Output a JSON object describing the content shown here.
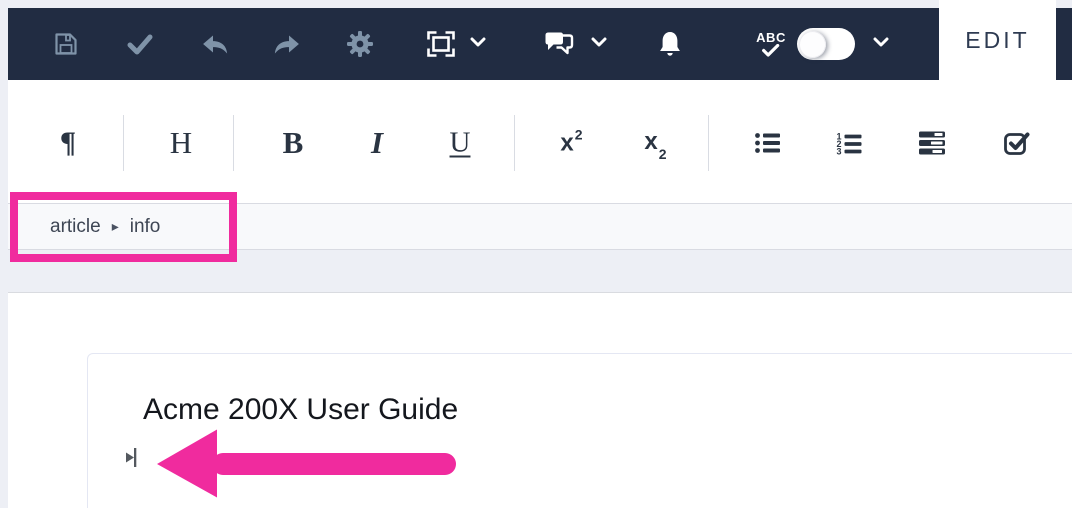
{
  "colors": {
    "accent_pink": "#f02b9e",
    "topbar_bg": "#212c42",
    "muted_icon": "#7f93a8",
    "white_icon": "#ffffff",
    "format_icon": "#2a3442"
  },
  "top_toolbar": {
    "buttons": [
      {
        "id": "save",
        "icon": "floppy-icon"
      },
      {
        "id": "approve",
        "icon": "check-icon"
      },
      {
        "id": "undo",
        "icon": "undo-arrow-icon"
      },
      {
        "id": "redo",
        "icon": "redo-arrow-icon"
      },
      {
        "id": "settings",
        "icon": "gear-icon"
      },
      {
        "id": "layout-mode",
        "icon": "frame-corners-icon",
        "has_dropdown": true
      },
      {
        "id": "comments",
        "icon": "speech-bubbles-icon",
        "has_dropdown": true
      },
      {
        "id": "notifications",
        "icon": "bell-icon"
      },
      {
        "id": "spellcheck",
        "icon": "abc-check-icon",
        "has_dropdown": true
      }
    ],
    "spellcheck_label": "ABC",
    "spellcheck_toggle_state": "off",
    "edit_tab_label": "EDIT"
  },
  "format_toolbar": {
    "paragraph_label": "¶",
    "heading_label": "H",
    "bold_label": "B",
    "italic_label": "I",
    "underline_label": "U",
    "superscript": {
      "base": "x",
      "script": "2"
    },
    "subscript": {
      "base": "x",
      "script": "2"
    },
    "numbered_list_digits": [
      "1",
      "2",
      "3"
    ],
    "icons": [
      "bullet-list-icon",
      "numbered-list-icon",
      "block-list-icon",
      "checkbox-icon"
    ]
  },
  "breadcrumb": {
    "segments": [
      "article",
      "info"
    ],
    "separator": "▸"
  },
  "editor": {
    "title": "Acme 200X User Guide"
  }
}
